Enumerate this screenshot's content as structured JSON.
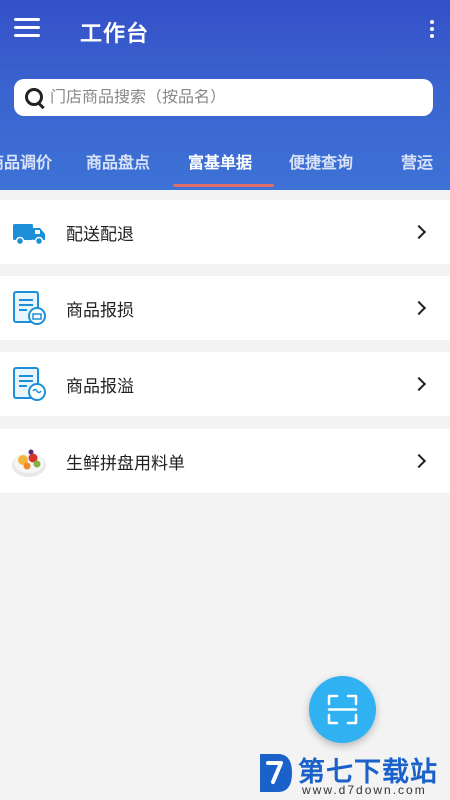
{
  "header": {
    "title": "工作台",
    "menu_icon": "hamburger-menu-icon",
    "more_icon": "more-vertical-icon"
  },
  "search": {
    "placeholder": "门店商品搜索（按品名）",
    "value": "",
    "icon": "search-icon"
  },
  "tabs": [
    {
      "label": "商品调价",
      "active": false
    },
    {
      "label": "商品盘点",
      "active": false
    },
    {
      "label": "富基单据",
      "active": true
    },
    {
      "label": "便捷查询",
      "active": false
    },
    {
      "label": "营运",
      "active": false
    }
  ],
  "list": [
    {
      "label": "配送配退",
      "icon": "delivery-truck-icon"
    },
    {
      "label": "商品报损",
      "icon": "damage-report-icon"
    },
    {
      "label": "商品报溢",
      "icon": "overflow-report-icon"
    },
    {
      "label": "生鲜拼盘用料单",
      "icon": "fruit-platter-icon"
    }
  ],
  "fab": {
    "icon": "scan-icon"
  },
  "watermark": {
    "title": "第七下载站",
    "url": "www.d7down.com"
  },
  "colors": {
    "header_top": "#3450c8",
    "header_bottom": "#3d72d6",
    "tab_indicator": "#e06c6c",
    "fab": "#2fb1f2",
    "icon_blue": "#1d8fd8"
  }
}
